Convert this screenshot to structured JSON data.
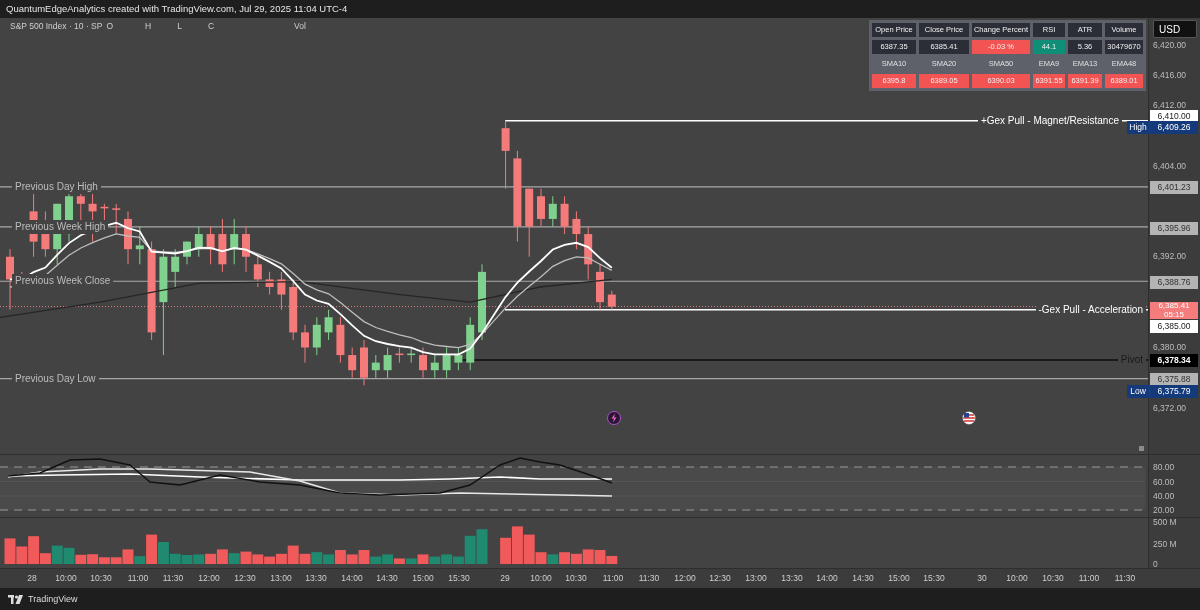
{
  "header": {
    "title": "QuantumEdgeAnalytics created with TradingView.com, Jul 29, 2025 11:04 UTC-4"
  },
  "legend": {
    "symbol": "S&P 500 Index · 10 · SP",
    "fields": [
      "O",
      "H",
      "L",
      "C",
      "Vol"
    ]
  },
  "stats_table": {
    "rows": [
      {
        "kind": "header",
        "cells": [
          {
            "text": "Open Price"
          },
          {
            "text": "Close Price"
          },
          {
            "text": "Change Percent"
          },
          {
            "text": "RSI"
          },
          {
            "text": "ATR"
          },
          {
            "text": "Volume"
          }
        ]
      },
      {
        "kind": "value",
        "cells": [
          {
            "text": "6387.35",
            "color": "#2b2e36"
          },
          {
            "text": "6385.41",
            "color": "#2b2e36"
          },
          {
            "text": "-0.03 %",
            "color": "#f25353"
          },
          {
            "text": "44.1",
            "color": "#0f8f78"
          },
          {
            "text": "5.36",
            "color": "#2b2e36"
          },
          {
            "text": "30479670",
            "color": "#2b2e36"
          }
        ]
      },
      {
        "kind": "label",
        "cells": [
          {
            "text": "SMA10"
          },
          {
            "text": "SMA20"
          },
          {
            "text": "SMA50"
          },
          {
            "text": "EMA9"
          },
          {
            "text": "EMA13"
          },
          {
            "text": "EMA48"
          }
        ]
      },
      {
        "kind": "value",
        "cells": [
          {
            "text": "6395.8",
            "color": "#f25353"
          },
          {
            "text": "6389.05",
            "color": "#f25353"
          },
          {
            "text": "6390.03",
            "color": "#f25353"
          },
          {
            "text": "6391.55",
            "color": "#f25353"
          },
          {
            "text": "6391.39",
            "color": "#f25353"
          },
          {
            "text": "6389.01",
            "color": "#f25353"
          }
        ]
      }
    ]
  },
  "currency_button": "USD",
  "price_axis": {
    "ticks": [
      "6,420.00",
      "6,416.00",
      "6,412.00",
      "6,404.00",
      "6,392.00",
      "6,380.00",
      "6,372.00"
    ]
  },
  "levels": [
    {
      "label": "+Gex Pull - Magnet/Resistance",
      "kind": "gex",
      "tag": "6,410.00"
    },
    {
      "label": "Previous Day High",
      "kind": "reference",
      "tag": "6,401.23"
    },
    {
      "label": "Previous Week High",
      "kind": "reference",
      "tag": "6,395.96"
    },
    {
      "label": "Previous Week Close",
      "kind": "reference",
      "tag": "6,388.76"
    },
    {
      "label": "-Gex Pull - Acceleration",
      "kind": "gex",
      "tag": "6,385.00"
    },
    {
      "label": "Pivot",
      "kind": "pivot",
      "tag": "6,378.34"
    },
    {
      "label": "Previous Day Low",
      "kind": "reference",
      "tag": "6,375.88"
    }
  ],
  "markers": [
    {
      "kind": "high",
      "label": "High",
      "value": "6,409.26"
    },
    {
      "kind": "last",
      "value": "6,385.41",
      "countdown": "05:15"
    },
    {
      "kind": "low",
      "label": "Low",
      "value": "6,375.79"
    }
  ],
  "oscillator_axis": [
    "80.00",
    "60.00",
    "40.00",
    "20.00"
  ],
  "volume_axis": [
    "500 M",
    "250 M",
    "0"
  ],
  "time_axis": [
    "28",
    "10:00",
    "10:30",
    "11:00",
    "11:30",
    "12:00",
    "12:30",
    "13:00",
    "13:30",
    "14:00",
    "14:30",
    "15:00",
    "15:30",
    "29",
    "10:00",
    "10:30",
    "11:00",
    "11:30",
    "12:00",
    "12:30",
    "13:00",
    "13:30",
    "14:00",
    "14:30",
    "15:00",
    "15:30",
    "30",
    "10:00",
    "10:30",
    "11:00",
    "11:30"
  ],
  "footer": {
    "brand": "TradingView"
  }
}
